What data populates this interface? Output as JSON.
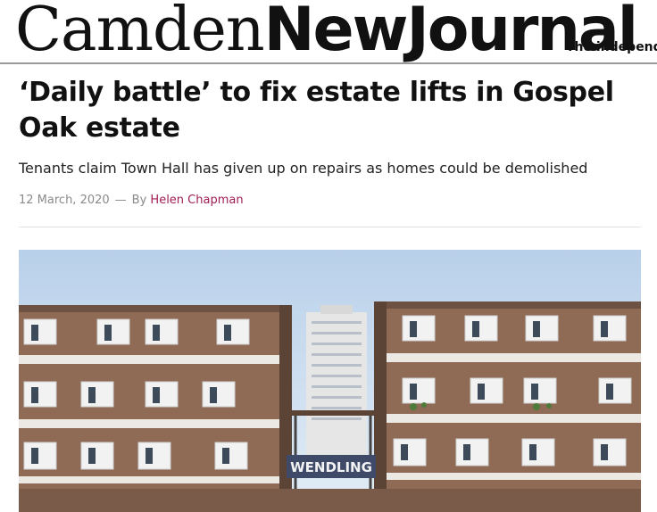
{
  "masthead": {
    "logo_light": "Camden",
    "logo_bold": "NewJournal",
    "tagline": "The independent"
  },
  "article": {
    "headline": "‘Daily battle’ to fix estate lifts in Gospel Oak estate",
    "standfirst": "Tenants claim Town Hall has given up on repairs as homes could be demolished",
    "date": "12 March, 2020",
    "separator": "—",
    "by_label": "By",
    "author": "Helen Chapman"
  },
  "photo": {
    "sign_text": "WENDLING"
  },
  "colors": {
    "author_link": "#a01d55",
    "meta_grey": "#8a8a8a",
    "brick": "#8f6a55",
    "sky": "#c9dbee"
  }
}
